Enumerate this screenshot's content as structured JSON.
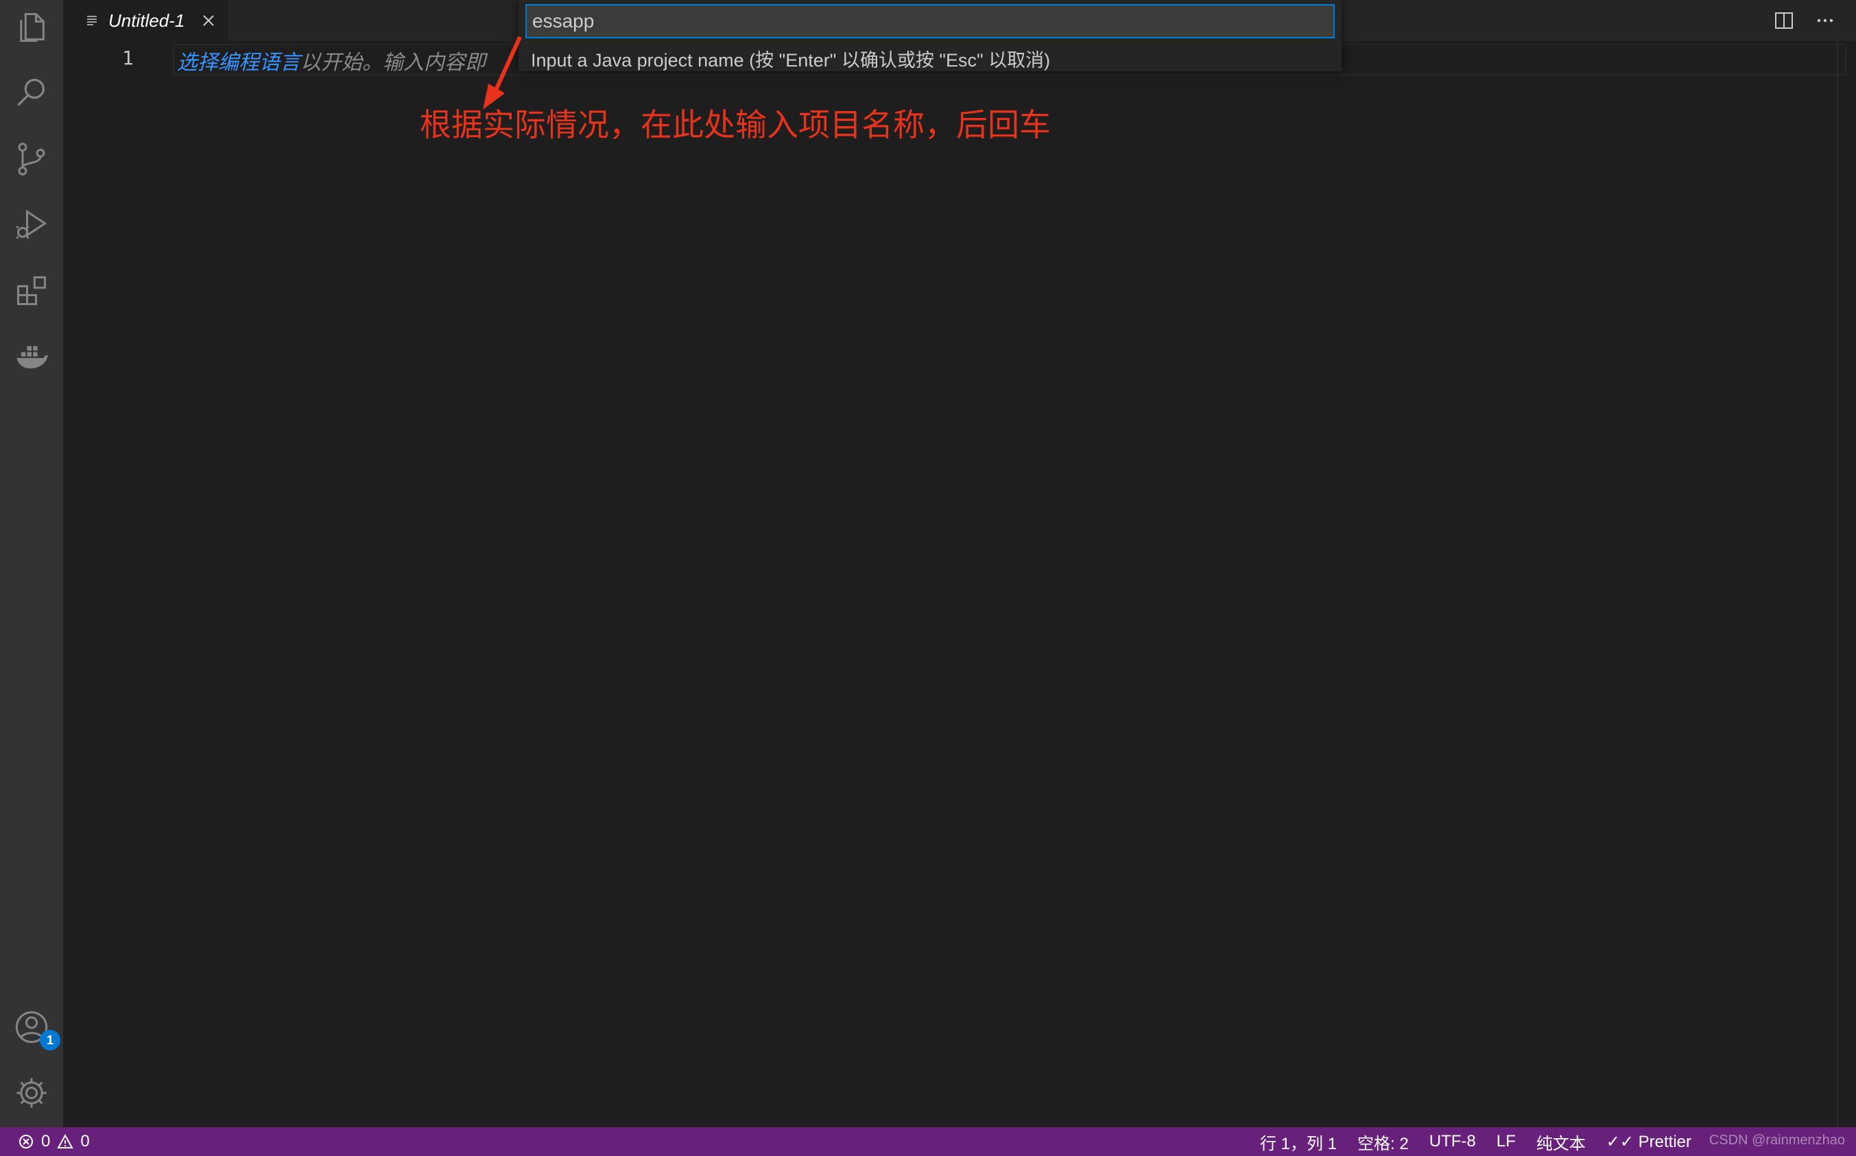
{
  "tab": {
    "title": "Untitled-1"
  },
  "editor": {
    "line_number": "1",
    "placeholder_link": "选择编程语言",
    "placeholder_rest": "以开始。输入内容即"
  },
  "quick_input": {
    "value": "essapp",
    "message": "Input a Java project name (按 \"Enter\" 以确认或按 \"Esc\" 以取消)"
  },
  "annotation": {
    "text": "根据实际情况，在此处输入项目名称，后回车"
  },
  "activity_bar": {
    "accounts_badge": "1"
  },
  "status_bar": {
    "errors": "0",
    "warnings": "0",
    "position": "行 1，列 1",
    "spaces": "空格: 2",
    "encoding": "UTF-8",
    "eol": "LF",
    "language": "纯文本",
    "formatter": "Prettier",
    "watermark": "CSDN @rainmenzhao"
  },
  "colors": {
    "accent": "#0078d4",
    "status_bar": "#68217a",
    "annotation": "#e8321c",
    "link": "#3794ff"
  }
}
